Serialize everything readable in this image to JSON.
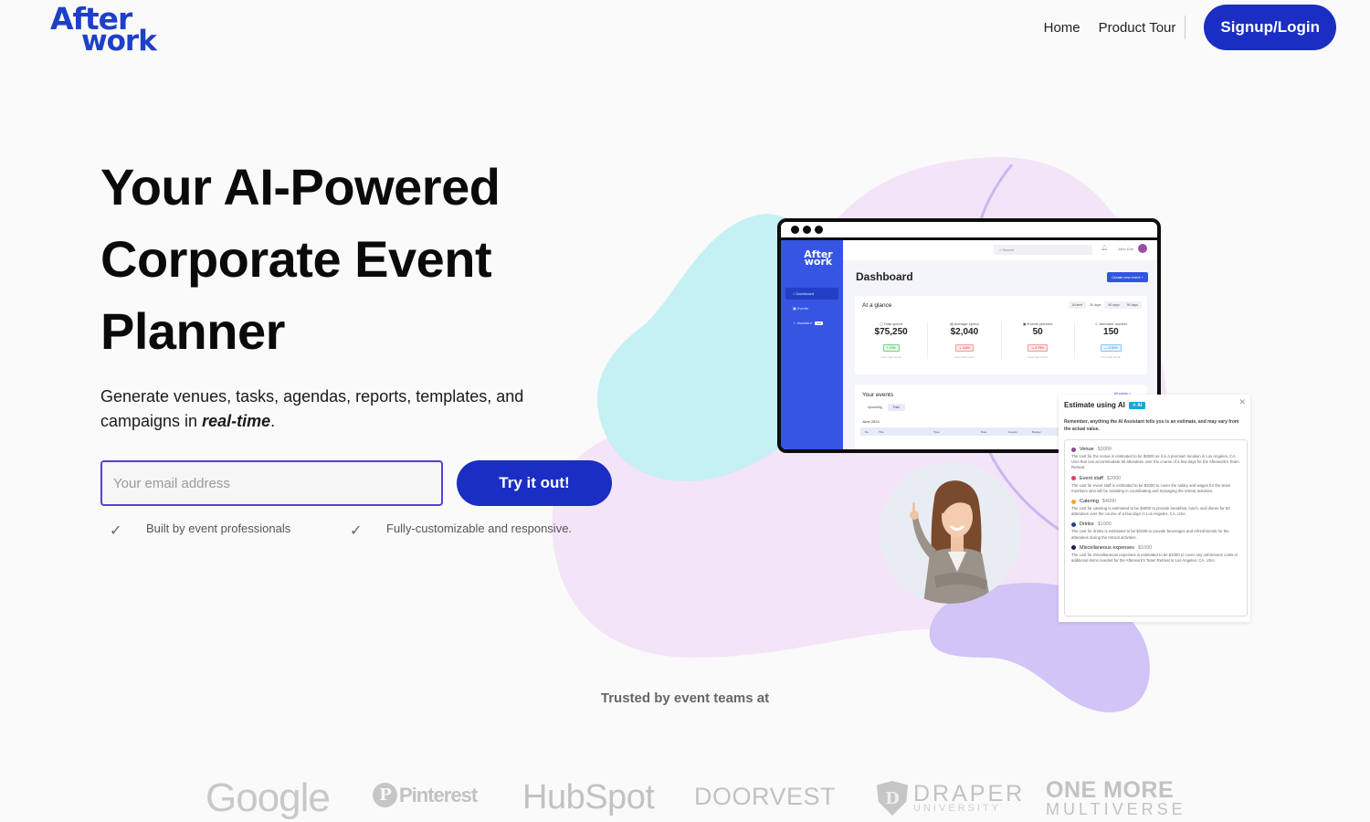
{
  "brand": {
    "logo_line1": "After",
    "logo_line2": "work",
    "primary_color": "#1a2ec4",
    "logo_color": "#1e40c8"
  },
  "nav": {
    "items": [
      {
        "label": "Home"
      },
      {
        "label": "Product Tour"
      }
    ],
    "cta_label": "Signup/Login"
  },
  "hero": {
    "headline": "Your AI-Powered Corporate Event Planner",
    "subtitle_prefix": "Generate venues, tasks, agendas, reports, templates, and campaigns in ",
    "subtitle_emphasis": "real-time",
    "subtitle_suffix": ".",
    "email_placeholder": "Your email address",
    "email_value": "",
    "cta_label": "Try it out!",
    "features": [
      {
        "icon": "check-icon",
        "label": "Built by event professionals"
      },
      {
        "icon": "check-icon",
        "label": "Fully-customizable and responsive."
      }
    ]
  },
  "dashboard_preview": {
    "logo_line1": "After",
    "logo_line2": "work",
    "sidebar": [
      {
        "label": "Dashboard",
        "active": true
      },
      {
        "label": "Events",
        "active": false
      },
      {
        "label": "Assistant",
        "active": false,
        "badge": "new"
      }
    ],
    "search_placeholder": "Search",
    "user_name": "John Doe",
    "title": "Dashboard",
    "create_button": "Create new event +",
    "glance": {
      "title": "At a glance",
      "ranges": [
        "All time",
        "30 days",
        "60 days",
        "90 days"
      ],
      "active_range": "30 days",
      "stats": [
        {
          "label": "Total spend",
          "value": "$75,250",
          "change": "+ 10%",
          "trend": "up",
          "footer": "From last month"
        },
        {
          "label": "Average spend",
          "value": "$2,040",
          "change": "↘ 3.6%",
          "trend": "down",
          "footer": "From last month"
        },
        {
          "label": "Events planned",
          "value": "50",
          "change": "↘ 9.75%",
          "trend": "down",
          "footer": "From last month"
        },
        {
          "label": "Attendee number",
          "value": "150",
          "change": "— 0.00%",
          "trend": "flat",
          "footer": "From last month"
        }
      ]
    },
    "events": {
      "title": "Your events",
      "see_all": "All events >",
      "tabs": [
        "Upcoming",
        "Past"
      ],
      "active_tab": "Upcoming",
      "month": "June 2024",
      "columns": [
        "No.",
        "Title",
        "Type",
        "Date",
        "Guests",
        "Budget"
      ]
    }
  },
  "ai_estimate": {
    "title": "Estimate using AI",
    "badge": "AI",
    "note": "Remember, anything the AI Assistant tells you is an estimate, and may vary from the actual value.",
    "items": [
      {
        "name": "Venue",
        "cost": "$3000",
        "color": "#8e4a8e",
        "description": "The cost for the venue is estimated to be $3000 as it is a premium location in Los Angeles, CA, USA that can accommodate 50 attendees over the course of a few days for the Afterwork's Team Retreat."
      },
      {
        "name": "Event staff",
        "cost": "$2000",
        "color": "#e0405a",
        "description": "The cost for event staff is estimated to be $2000 to cover the salary and wages for the team members who will be assisting in coordinating and managing the retreat activities."
      },
      {
        "name": "Catering",
        "cost": "$4000",
        "color": "#f5a623",
        "description": "The cost for catering is estimated to be $4000 to provide breakfast, lunch, and dinner for 50 attendees over the course of a few days in Los Angeles, CA, USA."
      },
      {
        "name": "Drinks",
        "cost": "$1000",
        "color": "#2c3e7a",
        "description": "The cost for drinks is estimated to be $1000 to provide beverages and refreshments for the attendees during the retreat activities."
      },
      {
        "name": "Miscellaneous expenses",
        "cost": "$1000",
        "color": "#1a2540",
        "description": "The cost for miscellaneous expenses is estimated to be $1000 to cover any unforeseen costs or additional items needed for the Afterwork's Team Retreat in Los Angeles, CA, USA."
      }
    ]
  },
  "trusted": {
    "heading": "Trusted by event teams at",
    "logos": [
      {
        "name": "Google"
      },
      {
        "name": "Pinterest"
      },
      {
        "name": "HubSpot"
      },
      {
        "name": "DOORVEST"
      },
      {
        "name": "DRAPER",
        "sub": "UNIVERSITY"
      },
      {
        "name": "ONE MORE",
        "sub": "MULTIVERSE"
      }
    ]
  }
}
